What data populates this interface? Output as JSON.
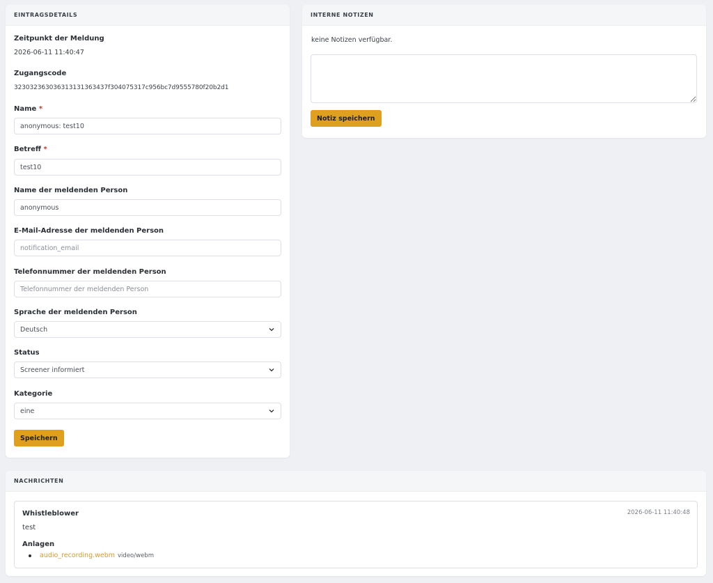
{
  "details": {
    "header": "EINTRAGSDETAILS",
    "time_label": "Zeitpunkt der Meldung",
    "time_value": "2026-06-11 11:40:47",
    "code_label": "Zugangscode",
    "code_value": "323032363036313131363437f304075317c956bc7d9555780f20b2d1",
    "name_label": "Name",
    "name_value": "anonymous: test10",
    "subject_label": "Betreff",
    "subject_value": "test10",
    "reporter_name_label": "Name der meldenden Person",
    "reporter_name_value": "anonymous",
    "email_label": "E-Mail-Adresse der meldenden Person",
    "email_placeholder": "notification_email",
    "phone_label": "Telefonnummer der meldenden Person",
    "phone_placeholder": "Telefonnummer der meldenden Person",
    "language_label": "Sprache der meldenden Person",
    "language_value": "Deutsch",
    "status_label": "Status",
    "status_value": "Screener informiert",
    "category_label": "Kategorie",
    "category_value": "eine",
    "required_marker": "*",
    "save_label": "Speichern"
  },
  "notes": {
    "header": "INTERNE NOTIZEN",
    "empty_text": "keine Notizen verfügbar.",
    "save_label": "Notiz speichern"
  },
  "messages": {
    "header": "NACHRICHTEN",
    "items": [
      {
        "author": "Whistleblower",
        "timestamp": "2026-06-11 11:40:48",
        "text": "test",
        "attachments_label": "Anlagen",
        "attachments": [
          {
            "name": "audio_recording.webm",
            "type": "video/webm"
          }
        ]
      }
    ]
  },
  "colors": {
    "accent": "#e0a01f",
    "link": "#d69a2a",
    "background": "#eef0f4",
    "required": "#c0392b"
  },
  "icons": {
    "select_chevron": "chevron-down-icon",
    "attachment_bullet": "bullet-icon"
  }
}
